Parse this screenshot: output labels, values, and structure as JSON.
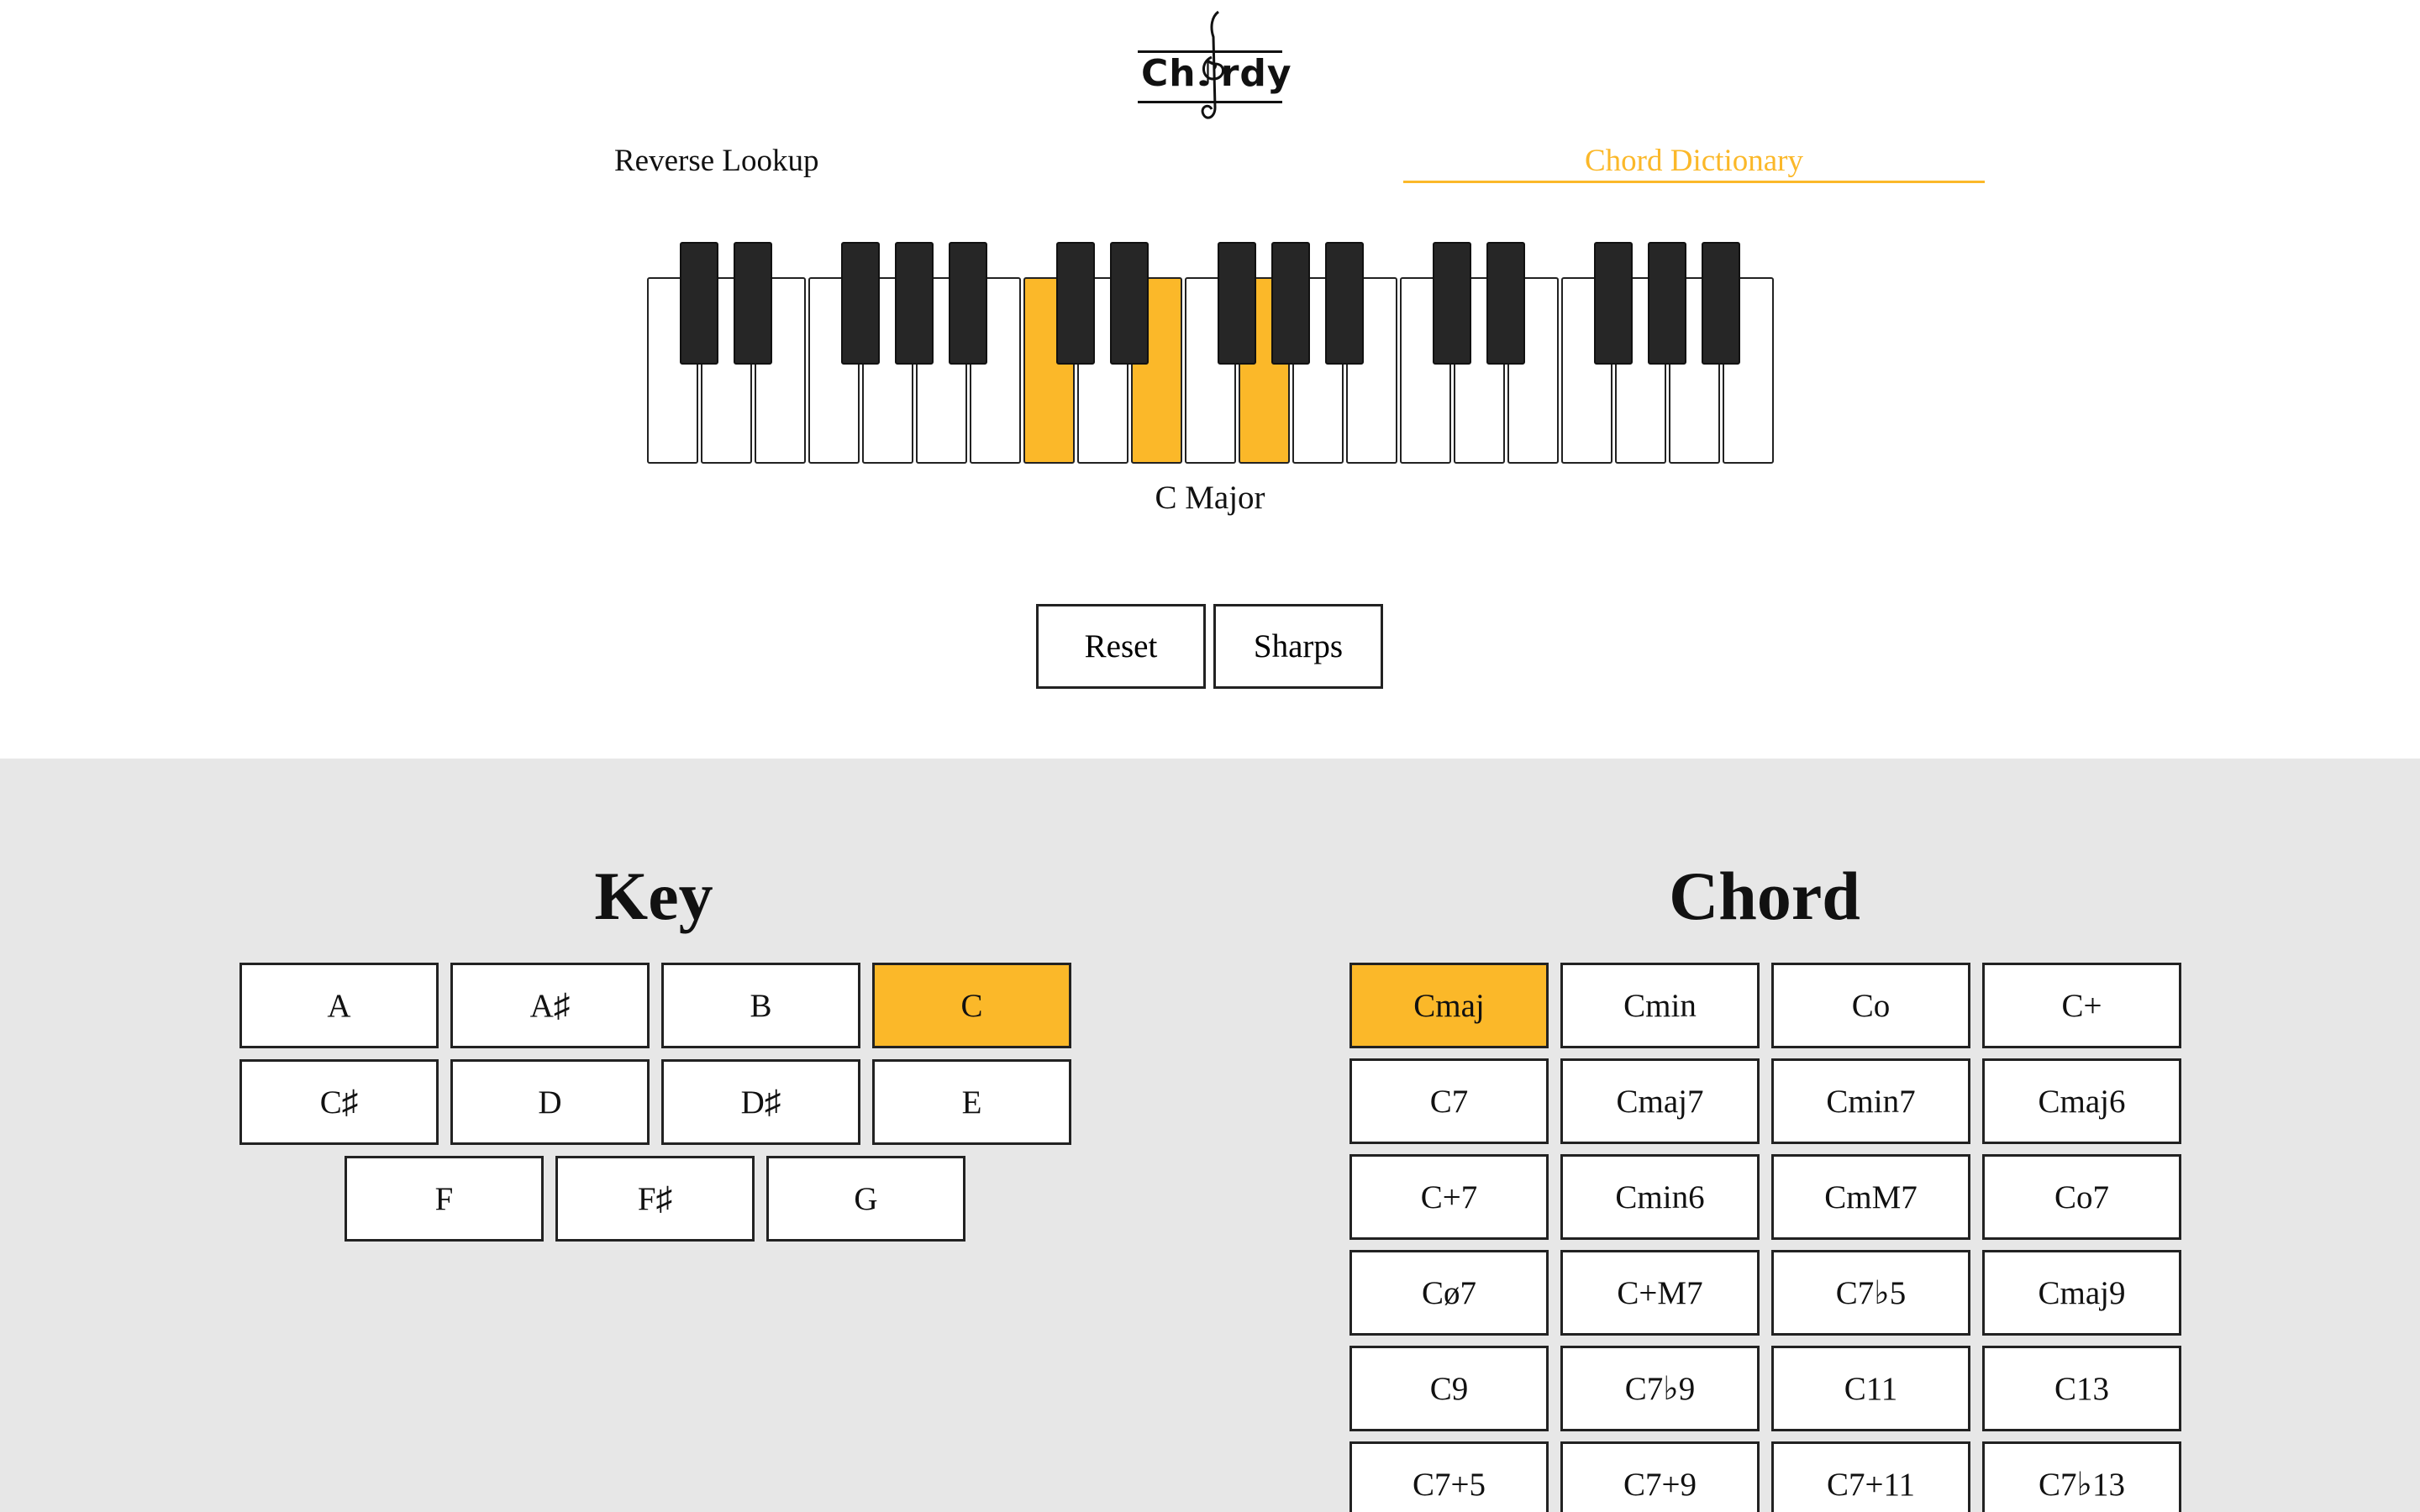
{
  "app": {
    "logo_text": "Ch♪rdy",
    "accent_color": "#fbb829"
  },
  "tabs": [
    {
      "label": "Reverse Lookup",
      "active": false
    },
    {
      "label": "Chord Dictionary",
      "active": true
    }
  ],
  "piano": {
    "white_keys": 21,
    "highlighted_white": [
      7,
      9,
      11
    ],
    "black_keys_count": 15,
    "highlighted_black": []
  },
  "chord_display": "C Major",
  "controls": {
    "reset_label": "Reset",
    "sharps_label": "Sharps"
  },
  "key_section": {
    "title": "Key",
    "keys": [
      "A",
      "A♯",
      "B",
      "C",
      "C♯",
      "D",
      "D♯",
      "E",
      "F",
      "F♯",
      "G"
    ],
    "selected": "C"
  },
  "chord_section": {
    "title": "Chord",
    "chords": [
      "Cmaj",
      "Cmin",
      "Co",
      "C+",
      "C7",
      "Cmaj7",
      "Cmin7",
      "Cmaj6",
      "C+7",
      "Cmin6",
      "CmM7",
      "Co7",
      "Cø7",
      "C+M7",
      "C7♭5",
      "Cmaj9",
      "C9",
      "C7♭9",
      "C11",
      "C13",
      "C7+5",
      "C7+9",
      "C7+11",
      "C7♭13"
    ],
    "selected": "Cmaj"
  }
}
